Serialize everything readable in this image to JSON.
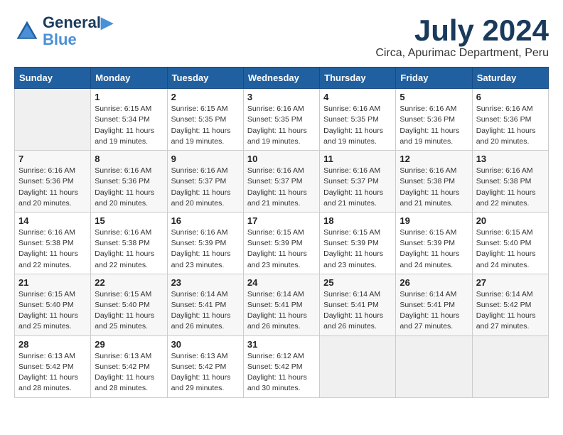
{
  "header": {
    "logo_line1": "General",
    "logo_line2": "Blue",
    "month_title": "July 2024",
    "subtitle": "Circa, Apurimac Department, Peru"
  },
  "days_of_week": [
    "Sunday",
    "Monday",
    "Tuesday",
    "Wednesday",
    "Thursday",
    "Friday",
    "Saturday"
  ],
  "weeks": [
    [
      {
        "day": "",
        "info": ""
      },
      {
        "day": "1",
        "info": "Sunrise: 6:15 AM\nSunset: 5:34 PM\nDaylight: 11 hours\nand 19 minutes."
      },
      {
        "day": "2",
        "info": "Sunrise: 6:15 AM\nSunset: 5:35 PM\nDaylight: 11 hours\nand 19 minutes."
      },
      {
        "day": "3",
        "info": "Sunrise: 6:16 AM\nSunset: 5:35 PM\nDaylight: 11 hours\nand 19 minutes."
      },
      {
        "day": "4",
        "info": "Sunrise: 6:16 AM\nSunset: 5:35 PM\nDaylight: 11 hours\nand 19 minutes."
      },
      {
        "day": "5",
        "info": "Sunrise: 6:16 AM\nSunset: 5:36 PM\nDaylight: 11 hours\nand 19 minutes."
      },
      {
        "day": "6",
        "info": "Sunrise: 6:16 AM\nSunset: 5:36 PM\nDaylight: 11 hours\nand 20 minutes."
      }
    ],
    [
      {
        "day": "7",
        "info": "Sunrise: 6:16 AM\nSunset: 5:36 PM\nDaylight: 11 hours\nand 20 minutes."
      },
      {
        "day": "8",
        "info": "Sunrise: 6:16 AM\nSunset: 5:36 PM\nDaylight: 11 hours\nand 20 minutes."
      },
      {
        "day": "9",
        "info": "Sunrise: 6:16 AM\nSunset: 5:37 PM\nDaylight: 11 hours\nand 20 minutes."
      },
      {
        "day": "10",
        "info": "Sunrise: 6:16 AM\nSunset: 5:37 PM\nDaylight: 11 hours\nand 21 minutes."
      },
      {
        "day": "11",
        "info": "Sunrise: 6:16 AM\nSunset: 5:37 PM\nDaylight: 11 hours\nand 21 minutes."
      },
      {
        "day": "12",
        "info": "Sunrise: 6:16 AM\nSunset: 5:38 PM\nDaylight: 11 hours\nand 21 minutes."
      },
      {
        "day": "13",
        "info": "Sunrise: 6:16 AM\nSunset: 5:38 PM\nDaylight: 11 hours\nand 22 minutes."
      }
    ],
    [
      {
        "day": "14",
        "info": "Sunrise: 6:16 AM\nSunset: 5:38 PM\nDaylight: 11 hours\nand 22 minutes."
      },
      {
        "day": "15",
        "info": "Sunrise: 6:16 AM\nSunset: 5:38 PM\nDaylight: 11 hours\nand 22 minutes."
      },
      {
        "day": "16",
        "info": "Sunrise: 6:16 AM\nSunset: 5:39 PM\nDaylight: 11 hours\nand 23 minutes."
      },
      {
        "day": "17",
        "info": "Sunrise: 6:15 AM\nSunset: 5:39 PM\nDaylight: 11 hours\nand 23 minutes."
      },
      {
        "day": "18",
        "info": "Sunrise: 6:15 AM\nSunset: 5:39 PM\nDaylight: 11 hours\nand 23 minutes."
      },
      {
        "day": "19",
        "info": "Sunrise: 6:15 AM\nSunset: 5:39 PM\nDaylight: 11 hours\nand 24 minutes."
      },
      {
        "day": "20",
        "info": "Sunrise: 6:15 AM\nSunset: 5:40 PM\nDaylight: 11 hours\nand 24 minutes."
      }
    ],
    [
      {
        "day": "21",
        "info": "Sunrise: 6:15 AM\nSunset: 5:40 PM\nDaylight: 11 hours\nand 25 minutes."
      },
      {
        "day": "22",
        "info": "Sunrise: 6:15 AM\nSunset: 5:40 PM\nDaylight: 11 hours\nand 25 minutes."
      },
      {
        "day": "23",
        "info": "Sunrise: 6:14 AM\nSunset: 5:41 PM\nDaylight: 11 hours\nand 26 minutes."
      },
      {
        "day": "24",
        "info": "Sunrise: 6:14 AM\nSunset: 5:41 PM\nDaylight: 11 hours\nand 26 minutes."
      },
      {
        "day": "25",
        "info": "Sunrise: 6:14 AM\nSunset: 5:41 PM\nDaylight: 11 hours\nand 26 minutes."
      },
      {
        "day": "26",
        "info": "Sunrise: 6:14 AM\nSunset: 5:41 PM\nDaylight: 11 hours\nand 27 minutes."
      },
      {
        "day": "27",
        "info": "Sunrise: 6:14 AM\nSunset: 5:42 PM\nDaylight: 11 hours\nand 27 minutes."
      }
    ],
    [
      {
        "day": "28",
        "info": "Sunrise: 6:13 AM\nSunset: 5:42 PM\nDaylight: 11 hours\nand 28 minutes."
      },
      {
        "day": "29",
        "info": "Sunrise: 6:13 AM\nSunset: 5:42 PM\nDaylight: 11 hours\nand 28 minutes."
      },
      {
        "day": "30",
        "info": "Sunrise: 6:13 AM\nSunset: 5:42 PM\nDaylight: 11 hours\nand 29 minutes."
      },
      {
        "day": "31",
        "info": "Sunrise: 6:12 AM\nSunset: 5:42 PM\nDaylight: 11 hours\nand 30 minutes."
      },
      {
        "day": "",
        "info": ""
      },
      {
        "day": "",
        "info": ""
      },
      {
        "day": "",
        "info": ""
      }
    ]
  ]
}
